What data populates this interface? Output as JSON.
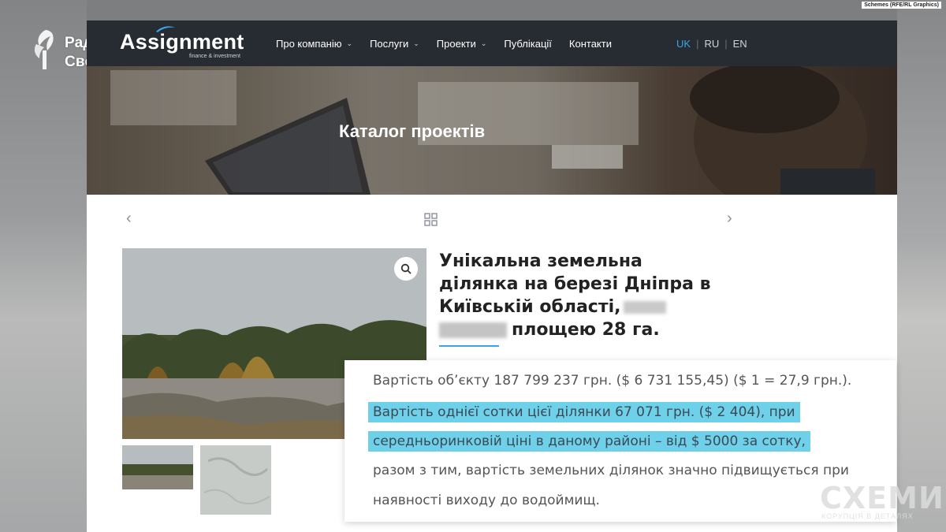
{
  "credit": "Schemes (RFE/RL Graphics)",
  "watermark_logo": {
    "line1": "Радіо",
    "line2": "Свобода"
  },
  "site": {
    "brand": {
      "name": "Assignment",
      "tagline": "finance & investment"
    },
    "menu": [
      {
        "label": "Про компанію",
        "has_dropdown": true
      },
      {
        "label": "Послуги",
        "has_dropdown": true
      },
      {
        "label": "Проекти",
        "has_dropdown": true
      },
      {
        "label": "Публікації",
        "has_dropdown": false
      },
      {
        "label": "Контакти",
        "has_dropdown": false
      }
    ],
    "languages": [
      "UK",
      "RU",
      "EN"
    ],
    "active_language": "UK",
    "hero_title": "Каталог проектів"
  },
  "project": {
    "title_line1": "Унікальна земельна",
    "title_line2": "ділянка на березі Дніпра в",
    "title_line3": "Київській області,",
    "title_line4": "площею 28 га."
  },
  "overlay": {
    "line1": "Вартість об’єкту 187 799 237 грн. ($ 6 731 155,45) ($ 1 = 27,9 грн.).",
    "line2": "Вартість однієї сотки цієї ділянки 67 071 грн. ($ 2 404), при",
    "line3": "середньоринковій ціні в даному районі – від $ 5000 за сотку,",
    "line4": "разом з тим, вартість земельних ділянок значно підвищується при",
    "line5": "наявності виходу до водоймищ."
  },
  "schemes_logo": {
    "title": "СХЕМИ",
    "subtitle": "КОРУПЦІЯ В ДЕТАЛЯХ"
  },
  "colors": {
    "nav_bg": "#272c33",
    "accent": "#3aa6e8",
    "highlight": "#6fd0ea"
  }
}
